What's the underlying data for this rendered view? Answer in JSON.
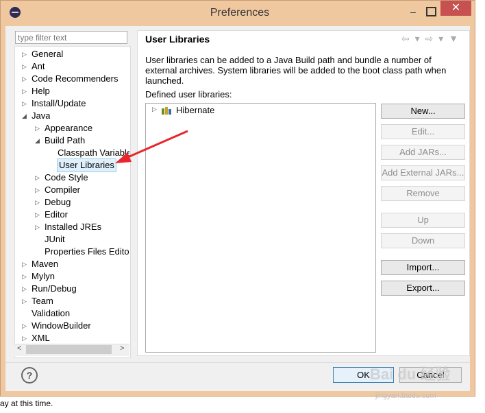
{
  "window": {
    "title": "Preferences",
    "minimize": "–",
    "close": "✕"
  },
  "filter": {
    "placeholder": "type filter text"
  },
  "tree": [
    {
      "label": "General",
      "arrow": "▷"
    },
    {
      "label": "Ant",
      "arrow": "▷"
    },
    {
      "label": "Code Recommenders",
      "arrow": "▷"
    },
    {
      "label": "Help",
      "arrow": "▷"
    },
    {
      "label": "Install/Update",
      "arrow": "▷"
    },
    {
      "label": "Java",
      "arrow": "◢"
    },
    {
      "label": "Appearance",
      "arrow": "▷"
    },
    {
      "label": "Build Path",
      "arrow": "◢"
    },
    {
      "label": "Classpath Variables",
      "arrow": ""
    },
    {
      "label": "User Libraries",
      "arrow": "",
      "selected": true
    },
    {
      "label": "Code Style",
      "arrow": "▷"
    },
    {
      "label": "Compiler",
      "arrow": "▷"
    },
    {
      "label": "Debug",
      "arrow": "▷"
    },
    {
      "label": "Editor",
      "arrow": "▷"
    },
    {
      "label": "Installed JREs",
      "arrow": "▷"
    },
    {
      "label": "JUnit",
      "arrow": ""
    },
    {
      "label": "Properties Files Editor",
      "arrow": ""
    },
    {
      "label": "Maven",
      "arrow": "▷"
    },
    {
      "label": "Mylyn",
      "arrow": "▷"
    },
    {
      "label": "Run/Debug",
      "arrow": "▷"
    },
    {
      "label": "Team",
      "arrow": "▷"
    },
    {
      "label": "Validation",
      "arrow": ""
    },
    {
      "label": "WindowBuilder",
      "arrow": "▷"
    },
    {
      "label": "XML",
      "arrow": "▷"
    }
  ],
  "scroll": {
    "left": "<",
    "right": ">"
  },
  "page": {
    "title": "User Libraries",
    "nav": "⇦ ▾ ⇨ ▾ ▼",
    "description": "User libraries can be added to a Java Build path and bundle a number of external archives. System libraries will be added to the boot class path when launched.",
    "defined_label": "Defined user libraries:",
    "libraries": [
      {
        "name": "Hibernate",
        "arrow": "▷"
      }
    ]
  },
  "buttons": {
    "new": "New...",
    "edit": "Edit...",
    "add_jars": "Add JARs...",
    "add_external_jars": "Add External JARs...",
    "remove": "Remove",
    "up": "Up",
    "down": "Down",
    "import": "Import...",
    "export": "Export..."
  },
  "footer": {
    "help": "?",
    "ok": "OK",
    "cancel": "Cancel"
  },
  "outside": {
    "text": "ay at this time."
  },
  "watermark": {
    "brand": "Bai du 经验",
    "url": "jingyan.baidu.com"
  },
  "colors": {
    "titlebar": "#f0c8a0",
    "close": "#c75050",
    "arrow": "#e8262b",
    "selection": "#dff0fb"
  }
}
